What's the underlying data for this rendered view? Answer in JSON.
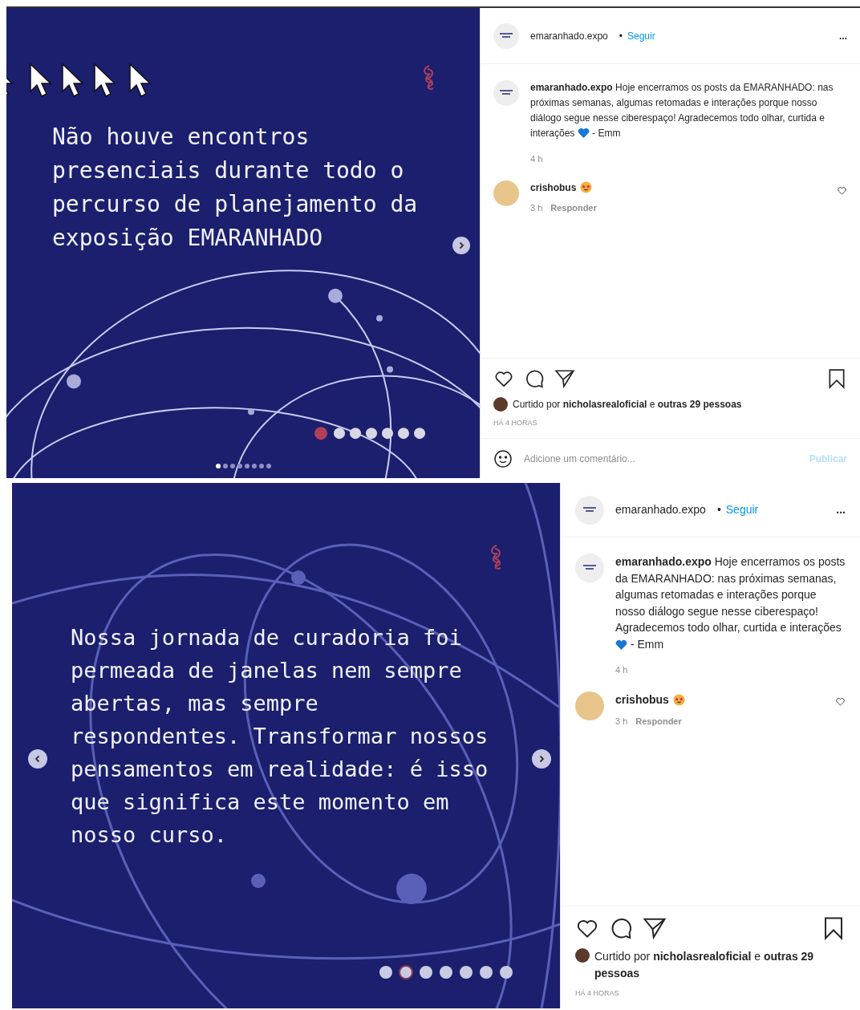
{
  "posts": [
    {
      "slide": {
        "text": "Não houve encontros presenciais durante todo o percurso de planejamento da exposição EMARANHADO",
        "has_prev": false,
        "has_next": true,
        "carousel": [
          {
            "selected": true
          },
          {
            "selected": false
          },
          {
            "selected": false
          },
          {
            "selected": false
          },
          {
            "selected": false
          },
          {
            "selected": false
          },
          {
            "selected": false
          },
          {
            "selected": false
          }
        ]
      },
      "header": {
        "username": "emaranhado.expo",
        "separator": "•",
        "follow": "Seguir",
        "more": "..."
      },
      "caption": {
        "text": "**emaranhado.expo** Hoje encerramos os posts da EMARANHADO: nas próximas semanas, algumas retomadas e interações porque nosso diálogo segue nesse ciberespaço! Agradecemos todo olhar, curtida e interações",
        "after_emoji": "- Emm",
        "time": "4 h"
      },
      "comment": {
        "username": "crishobus",
        "time": "3 h",
        "reply": "Responder"
      },
      "likes": {
        "text": "Curtido por **nicholasrealoficial** e **outras 29 pessoas**",
        "time": "HÁ 4 HORAS"
      },
      "composer": {
        "placeholder": "Adicione um comentário...",
        "submit": "Publicar"
      }
    },
    {
      "slide": {
        "text": "Nossa jornada de curadoria foi permeada de janelas nem sempre abertas, mas sempre respondentes. Transformar nossos pensamentos em realidade: é isso que significa este momento em nosso curso.",
        "has_prev": true,
        "has_next": true
      },
      "header": {
        "username": "emaranhado.expo",
        "separator": "•",
        "follow": "Seguir",
        "more": "..."
      },
      "caption": {
        "text": "**emaranhado.expo** Hoje encerramos os posts da EMARANHADO: nas próximas semanas, algumas retomadas e interações porque nosso diálogo segue nesse ciberespaço! Agradecemos todo olhar, curtida e interações",
        "after_emoji": "- Emm",
        "time": "4 h"
      },
      "comment": {
        "username": "crishobus",
        "time": "3 h",
        "reply": "Responder"
      },
      "likes": {
        "text": "Curtido por **nicholasrealoficial** e **outras 29 pessoas**",
        "time": "HÁ 4 HORAS"
      }
    }
  ]
}
